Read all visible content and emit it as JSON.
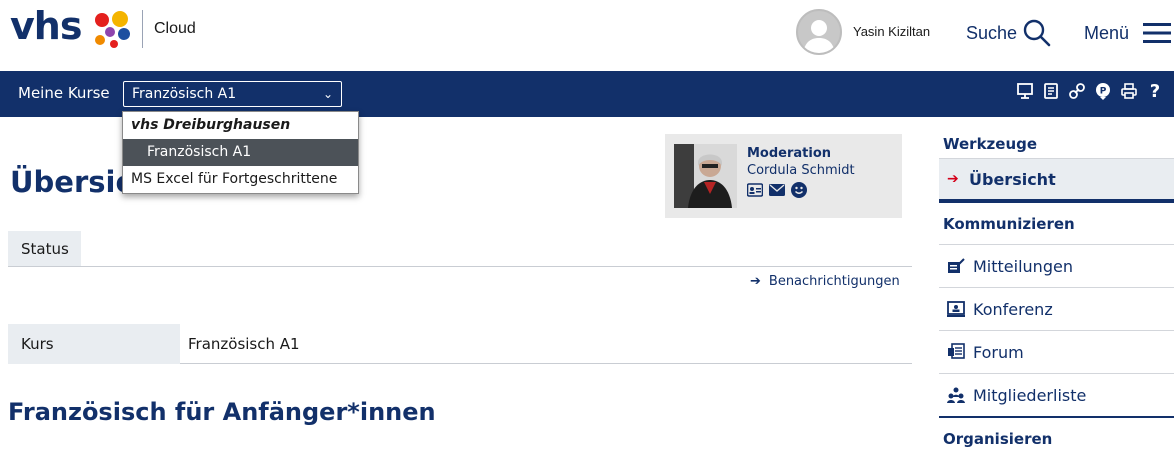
{
  "header": {
    "logo_text": "vhs",
    "product": "Cloud",
    "username": "Yasin Kiziltan",
    "search_label": "Suche",
    "menu_label": "Menü"
  },
  "coursebar": {
    "label": "Meine Kurse",
    "selected_course": "Französisch A1",
    "tool_icons": [
      "presentation-icon",
      "notes-icon",
      "link-icon",
      "marker-icon",
      "print-icon",
      "help-icon"
    ]
  },
  "dropdown": {
    "group": "vhs Dreiburghausen",
    "options": [
      {
        "label": "Französisch A1",
        "selected": true
      },
      {
        "label": "MS Excel für Fortgeschrittene",
        "selected": false
      }
    ]
  },
  "main": {
    "title": "Übersicht",
    "tab": "Status",
    "notification_link": "Benachrichtigungen",
    "kurs_label": "Kurs",
    "kurs_value": "Französisch A1",
    "course_heading": "Französisch für Anfänger*innen"
  },
  "moderation": {
    "title": "Moderation",
    "name": "Cordula Schmidt",
    "icons": [
      "contact-card-icon",
      "mail-icon",
      "smiley-icon"
    ]
  },
  "sidebar": {
    "tools_heading": "Werkzeuge",
    "overview": "Übersicht",
    "communicate_heading": "Kommunizieren",
    "items": [
      {
        "label": "Mitteilungen",
        "icon": "notes-edit-icon"
      },
      {
        "label": "Konferenz",
        "icon": "conference-icon"
      },
      {
        "label": "Forum",
        "icon": "forum-icon"
      },
      {
        "label": "Mitgliederliste",
        "icon": "members-icon"
      }
    ],
    "organize_heading": "Organisieren"
  },
  "colors": {
    "navy": "#12306a",
    "accent_red": "#d4001a",
    "light_gray": "#e9edf1"
  }
}
